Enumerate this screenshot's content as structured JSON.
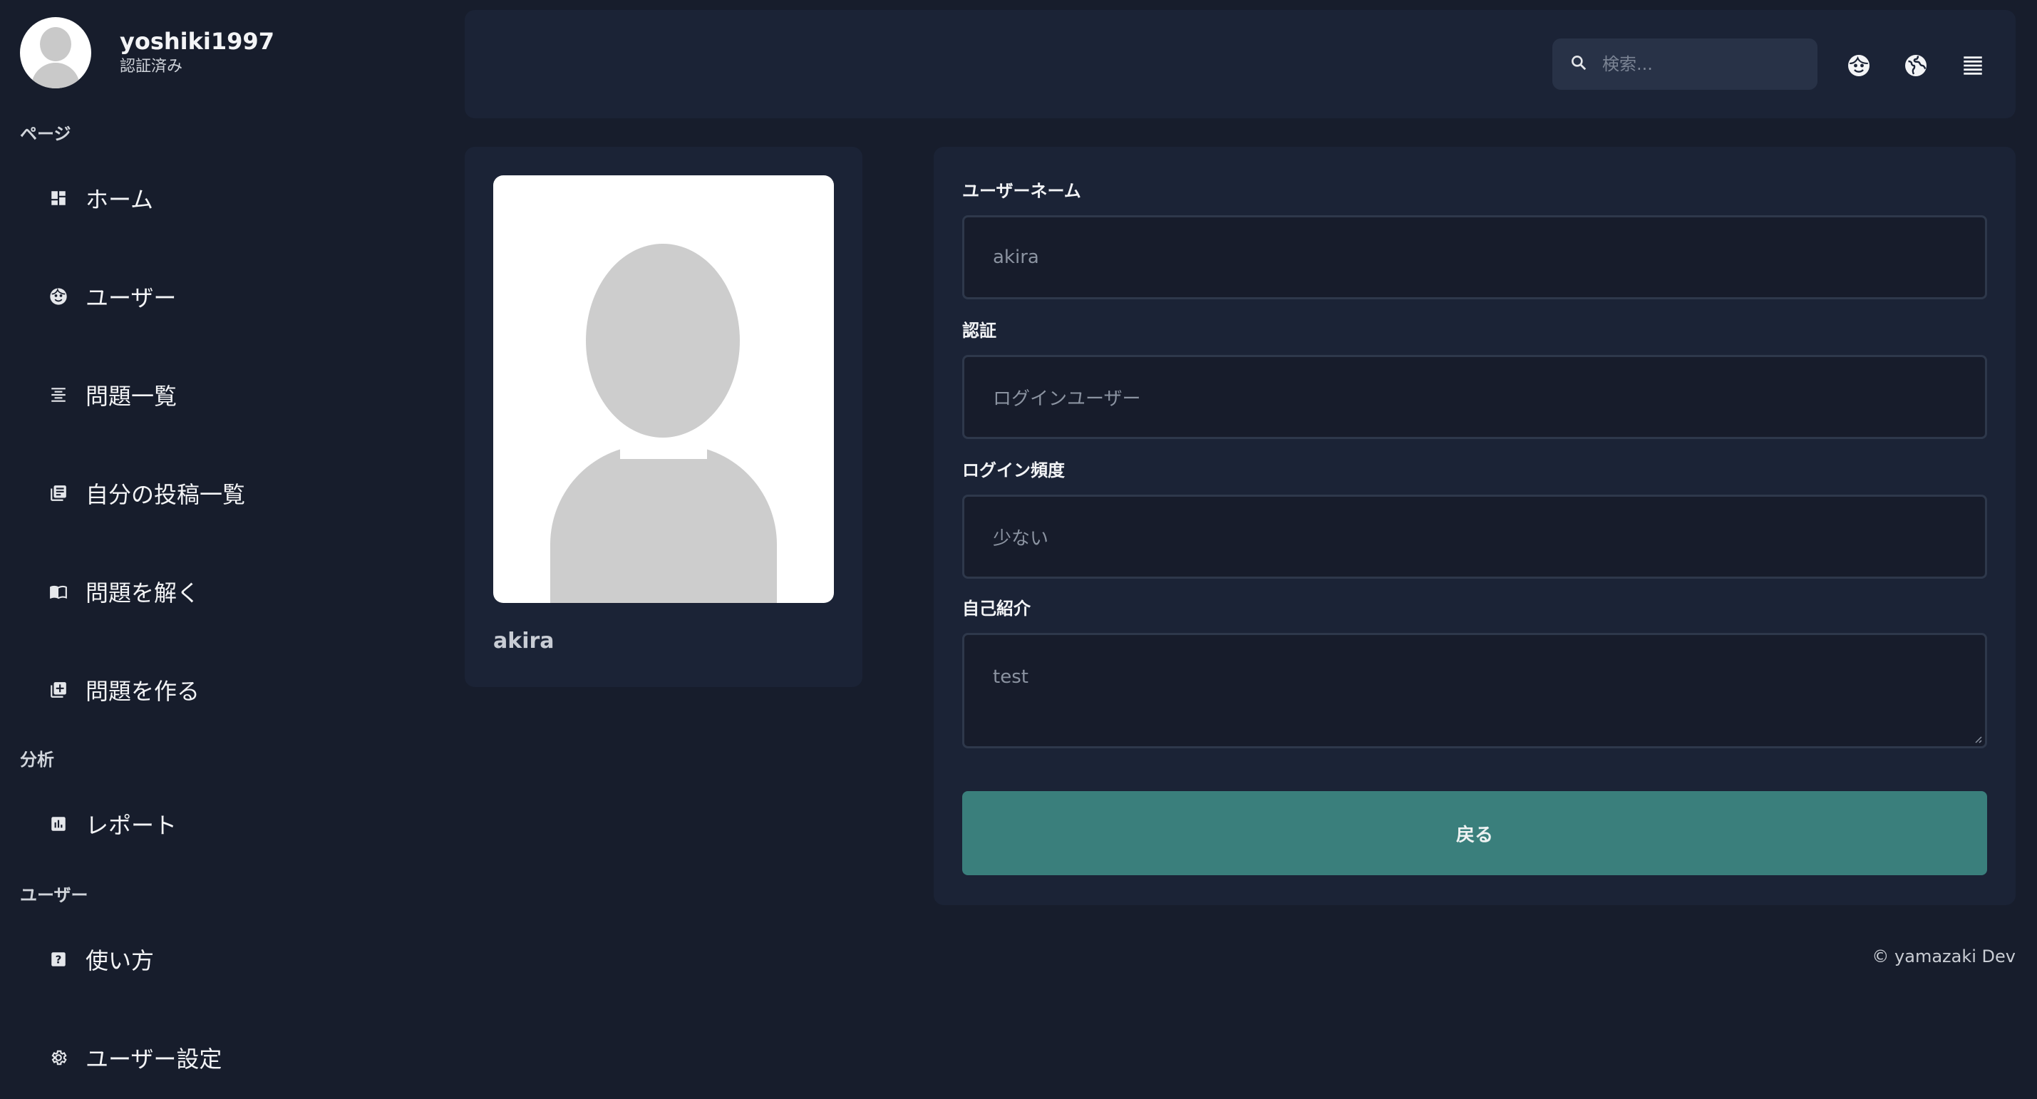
{
  "user": {
    "name": "yoshiki1997",
    "status": "認証済み"
  },
  "sidebar": {
    "sections": [
      {
        "label": "ページ"
      },
      {
        "label": "分析"
      },
      {
        "label": "ユーザー"
      }
    ],
    "items": [
      {
        "label": "ホーム",
        "icon": "dashboard-icon"
      },
      {
        "label": "ユーザー",
        "icon": "face-icon"
      },
      {
        "label": "問題一覧",
        "icon": "list-icon"
      },
      {
        "label": "自分の投稿一覧",
        "icon": "library-icon"
      },
      {
        "label": "問題を解く",
        "icon": "book-icon"
      },
      {
        "label": "問題を作る",
        "icon": "add-box-icon"
      },
      {
        "label": "レポート",
        "icon": "chart-icon"
      },
      {
        "label": "使い方",
        "icon": "help-icon"
      },
      {
        "label": "ユーザー設定",
        "icon": "gear-icon"
      }
    ]
  },
  "topbar": {
    "search_placeholder": "検索...",
    "icons": [
      "face-icon",
      "globe-icon",
      "menu-icon"
    ]
  },
  "profile_card": {
    "name": "akira"
  },
  "form": {
    "username_label": "ユーザーネーム",
    "username_value": "akira",
    "auth_label": "認証",
    "auth_value": "ログインユーザー",
    "frequency_label": "ログイン頻度",
    "frequency_value": "少ない",
    "bio_label": "自己紹介",
    "bio_value": "test",
    "back_button": "戻る"
  },
  "footer": {
    "text": "© yamazaki Dev"
  },
  "colors": {
    "background": "#171d2c",
    "card": "#1b2336",
    "accent": "#3a7f7c"
  }
}
